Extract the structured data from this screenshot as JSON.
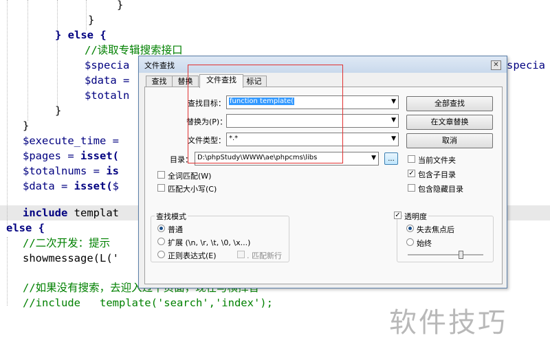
{
  "editor": {
    "lines": {
      "l0": "}",
      "l1": "}",
      "l2_kw": "} else {",
      "l3": "//读取专辑搜索接口",
      "l4": "$specia",
      "l4_right": "specia",
      "l5": "$data =",
      "l6": "$totaln",
      "l7": "}",
      "l8": "}",
      "l9": "$execute_time =",
      "l10_a": "$pages = ",
      "l10_b": "isset(",
      "l11_a": "$totalnums = ",
      "l11_b": "is",
      "l12_a": "$data = ",
      "l12_b": "isset(",
      "l12_c": "$",
      "l13_a": "include",
      "l13_b": " templat",
      "l14": "else {",
      "l15": "//二次开发：提示",
      "l16": "showmessage(L('",
      "l17": "//如果没有搜索，去迎入过平页面，现在与横挥替",
      "l18": "//include   template('search','index');"
    },
    "watermark": "软件技巧"
  },
  "dialog": {
    "title": "文件查找",
    "close_glyph": "✕",
    "tabs": [
      {
        "label": "查找",
        "active": false
      },
      {
        "label": "替换",
        "active": false
      },
      {
        "label": "文件查找",
        "active": true
      },
      {
        "label": "标记",
        "active": false
      }
    ],
    "find_label": "查找目标：",
    "find_value": "function template(",
    "replace_label": "替换为(P)：",
    "replace_value": "",
    "filetype_label": "文件类型：",
    "filetype_value": "*.*",
    "dir_label": "目录：",
    "dir_value": "D:\\phpStudy\\WWW\\ae\\phpcms\\libs",
    "browse_label": "...",
    "buttons": {
      "find_all": "全部查找",
      "replace_in_files": "在文章替换",
      "cancel": "取消"
    },
    "checkboxes": {
      "current_folder": {
        "label": "当前文件夹",
        "checked": false
      },
      "include_subdirs": {
        "label": "包含子目录",
        "checked": true
      },
      "include_hidden": {
        "label": "包含隐藏目录",
        "checked": false
      },
      "whole_word": {
        "label": "全词匹配(W)",
        "checked": false
      },
      "match_case": {
        "label": "匹配大小写(C)",
        "checked": false
      }
    },
    "search_mode": {
      "title": "查找模式",
      "normal": "普通",
      "extended": "扩展 (\\n, \\r, \\t, \\0, \\x...)",
      "regex": "正则表达式(E)",
      "dot_newline": ". 匹配新行",
      "selected": "normal"
    },
    "transparency": {
      "title": "透明度",
      "checked": true,
      "on_lose_focus": "失去焦点后",
      "always": "始终",
      "selected": "on_lose_focus"
    }
  },
  "colors": {
    "keyword": "#000080",
    "comment": "#008000",
    "annotation_box": "#e03030"
  }
}
